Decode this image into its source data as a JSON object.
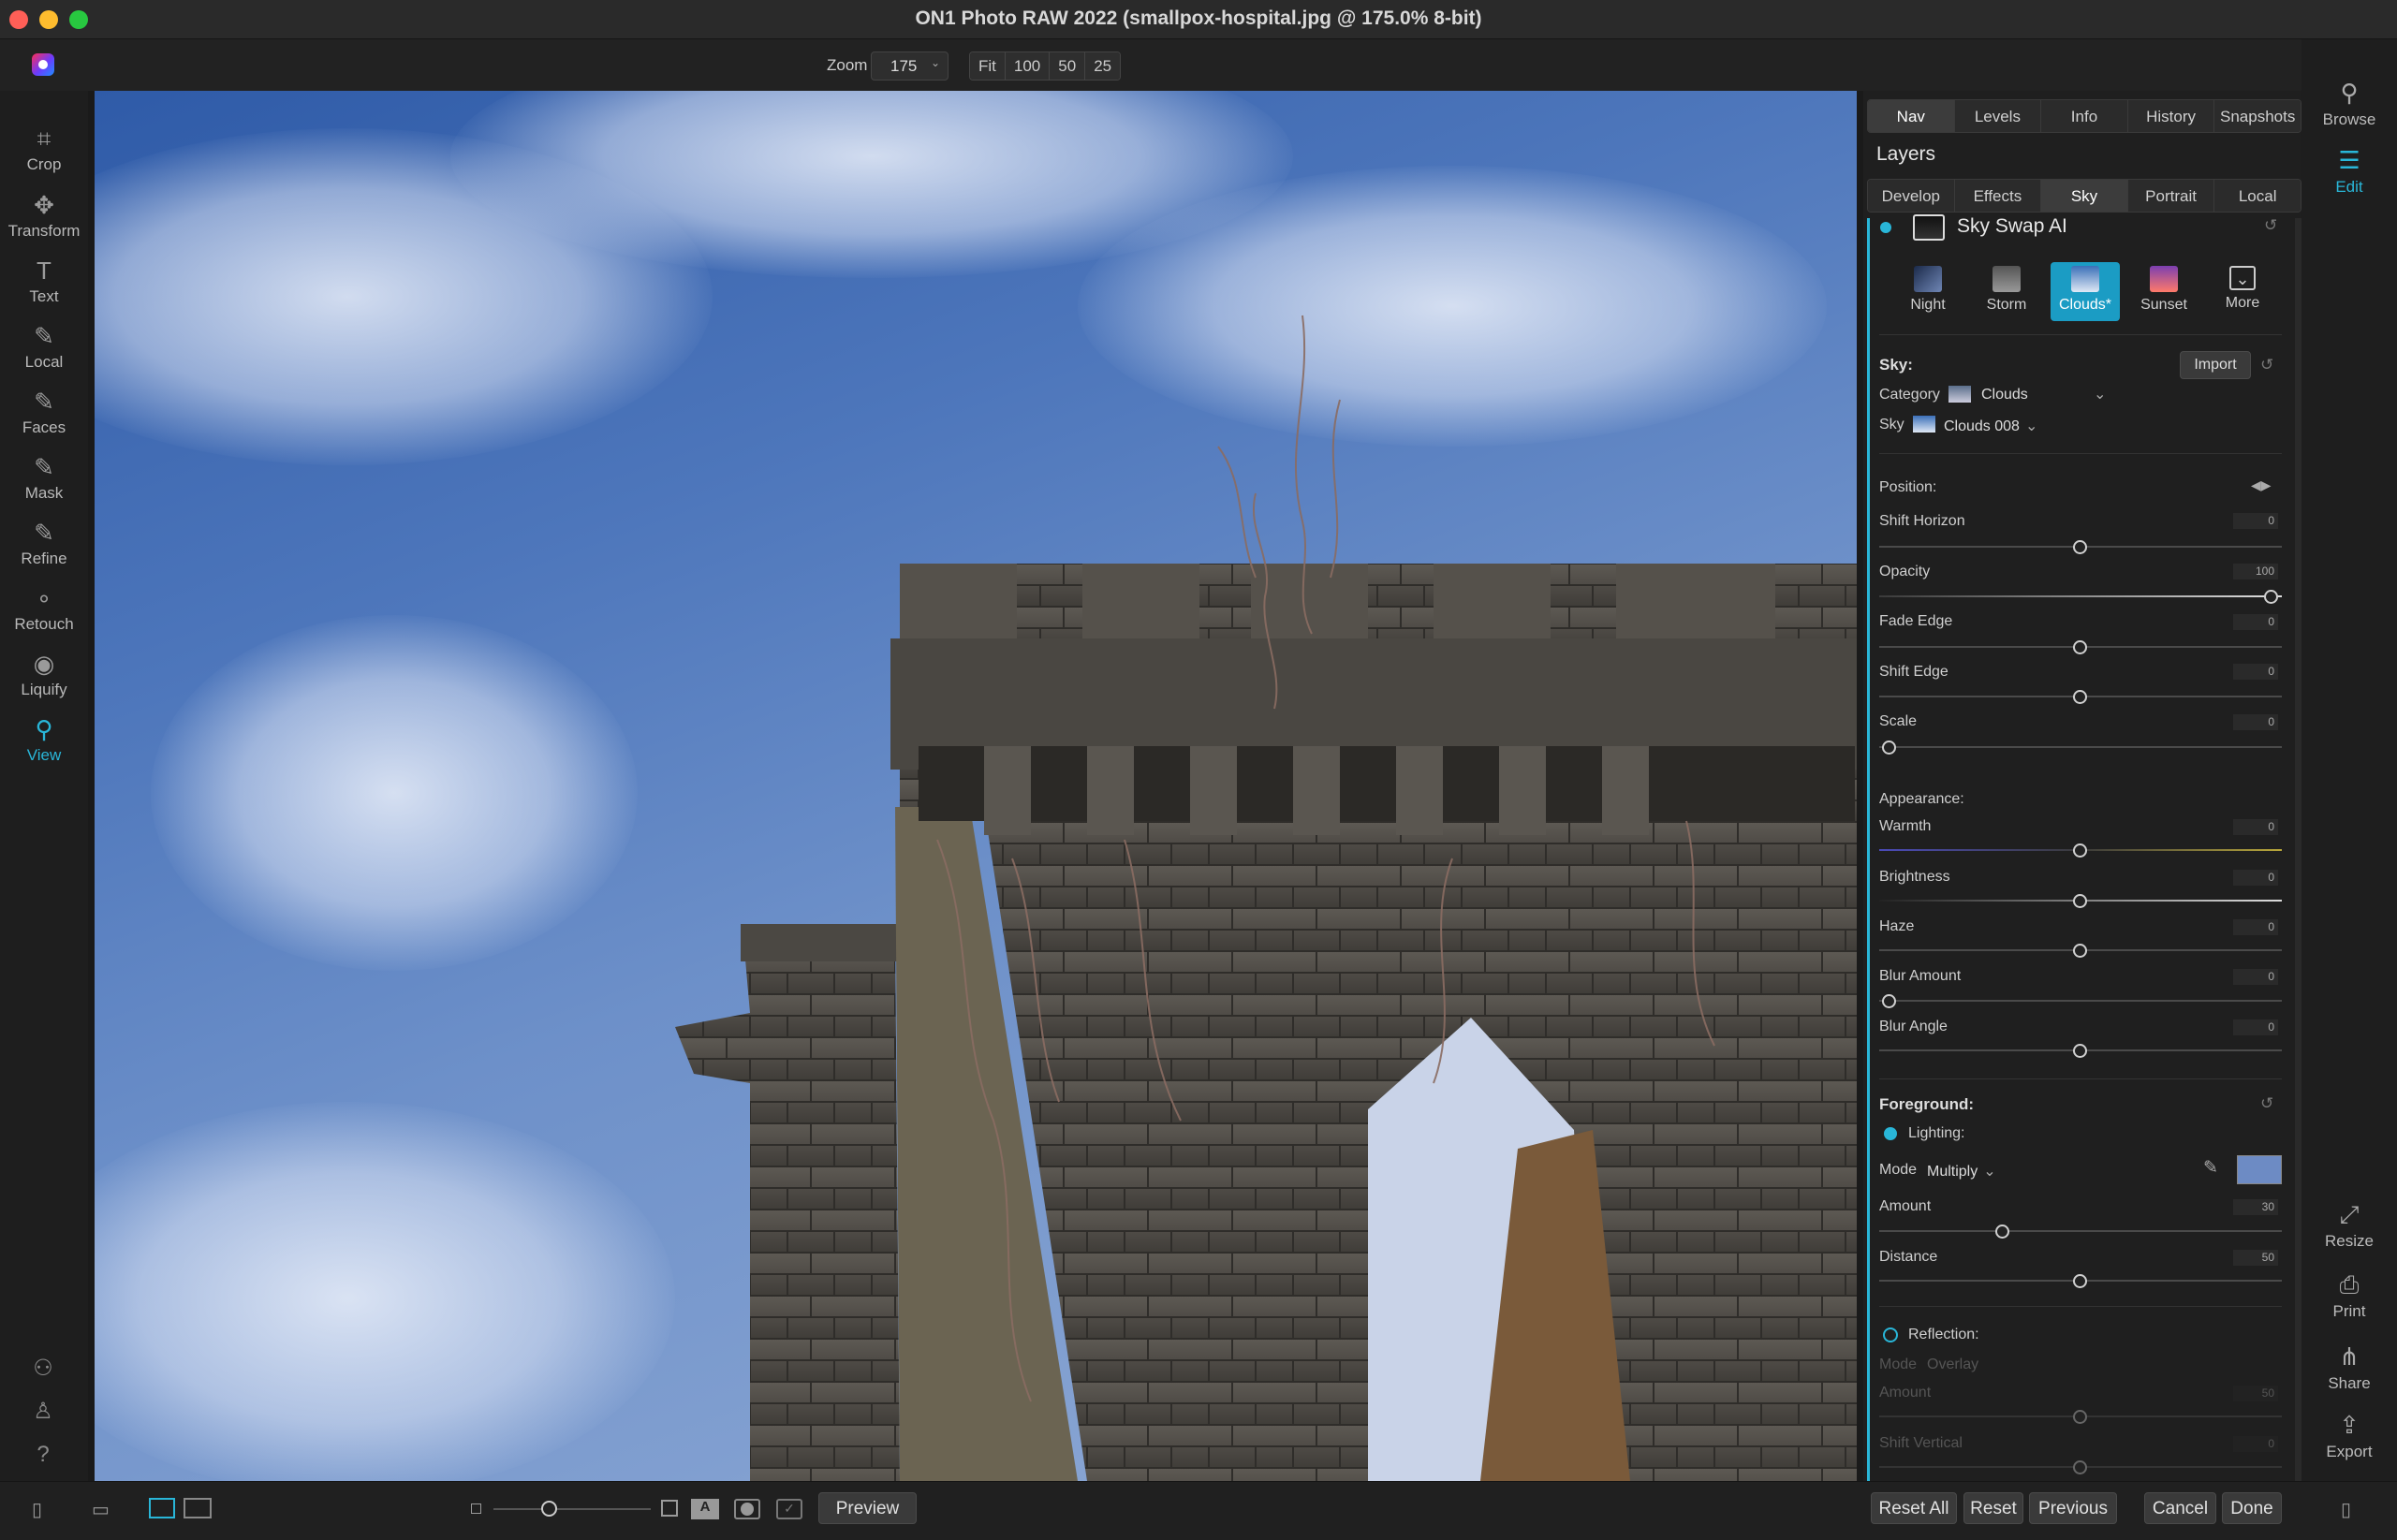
{
  "window": {
    "title": "ON1 Photo RAW 2022 (smallpox-hospital.jpg @ 175.0% 8-bit)"
  },
  "toolbar": {
    "zoom_label": "Zoom",
    "zoom_value": "175",
    "zoom_buttons": [
      "Fit",
      "100",
      "50",
      "25"
    ]
  },
  "left_tools": [
    {
      "label": "Crop",
      "icon": "crop-icon"
    },
    {
      "label": "Transform",
      "icon": "move-icon"
    },
    {
      "label": "Text",
      "icon": "text-icon"
    },
    {
      "label": "Local",
      "icon": "brush-icon"
    },
    {
      "label": "Faces",
      "icon": "face-brush-icon"
    },
    {
      "label": "Mask",
      "icon": "mask-brush-icon"
    },
    {
      "label": "Refine",
      "icon": "refine-brush-icon"
    },
    {
      "label": "Retouch",
      "icon": "retouch-icon"
    },
    {
      "label": "Liquify",
      "icon": "liquify-icon"
    },
    {
      "label": "View",
      "icon": "view-hand-icon",
      "active": true
    }
  ],
  "panel": {
    "top_tabs": [
      "Nav",
      "Levels",
      "Info",
      "History",
      "Snapshots"
    ],
    "top_tab_selected": "Nav",
    "layers_title": "Layers",
    "module_tabs": [
      "Develop",
      "Effects",
      "Sky",
      "Portrait",
      "Local"
    ],
    "module_tab_selected": "Sky",
    "filter_title": "Sky Swap AI",
    "presets": [
      {
        "label": "Night",
        "selected": false
      },
      {
        "label": "Storm",
        "selected": false
      },
      {
        "label": "Clouds*",
        "selected": true
      },
      {
        "label": "Sunset",
        "selected": false
      },
      {
        "label": "More",
        "selected": false
      }
    ],
    "sky": {
      "heading": "Sky:",
      "import_label": "Import",
      "category_label": "Category",
      "category_value": "Clouds",
      "sky_label": "Sky",
      "sky_value": "Clouds 008"
    },
    "position": {
      "heading": "Position:",
      "sliders": [
        {
          "label": "Shift Horizon",
          "value": "0"
        },
        {
          "label": "Opacity",
          "value": "100"
        },
        {
          "label": "Fade Edge",
          "value": "0"
        },
        {
          "label": "Shift Edge",
          "value": "0"
        },
        {
          "label": "Scale",
          "value": "0"
        }
      ]
    },
    "appearance": {
      "heading": "Appearance:",
      "sliders": [
        {
          "label": "Warmth",
          "value": "0"
        },
        {
          "label": "Brightness",
          "value": "0"
        },
        {
          "label": "Haze",
          "value": "0"
        },
        {
          "label": "Blur Amount",
          "value": "0"
        },
        {
          "label": "Blur Angle",
          "value": "0"
        }
      ]
    },
    "foreground": {
      "heading": "Foreground:",
      "lighting_label": "Lighting:",
      "mode_label": "Mode",
      "mode_value": "Multiply",
      "color": "#6d8bc4",
      "amount_label": "Amount",
      "amount_value": "30",
      "distance_label": "Distance",
      "distance_value": "50",
      "reflection_label": "Reflection:",
      "refl_mode_label": "Mode",
      "refl_mode_value": "Overlay",
      "refl_amount_label": "Amount",
      "refl_amount_value": "50",
      "refl_shift_label": "Shift Vertical",
      "refl_shift_value": "0"
    }
  },
  "right_nav": [
    {
      "label": "Browse",
      "icon": "browse-icon"
    },
    {
      "label": "Edit",
      "icon": "edit-sliders-icon",
      "active": true
    },
    {
      "label": "Resize",
      "icon": "resize-icon"
    },
    {
      "label": "Print",
      "icon": "print-icon"
    },
    {
      "label": "Share",
      "icon": "share-icon"
    },
    {
      "label": "Export",
      "icon": "export-icon"
    }
  ],
  "bottom": {
    "preview_label": "Preview",
    "buttons": [
      "Reset All",
      "Reset",
      "Previous",
      "Cancel",
      "Done"
    ]
  },
  "colors": {
    "accent": "#29b6d8",
    "sky": "#4d76bb",
    "stone": "#5a5650"
  }
}
